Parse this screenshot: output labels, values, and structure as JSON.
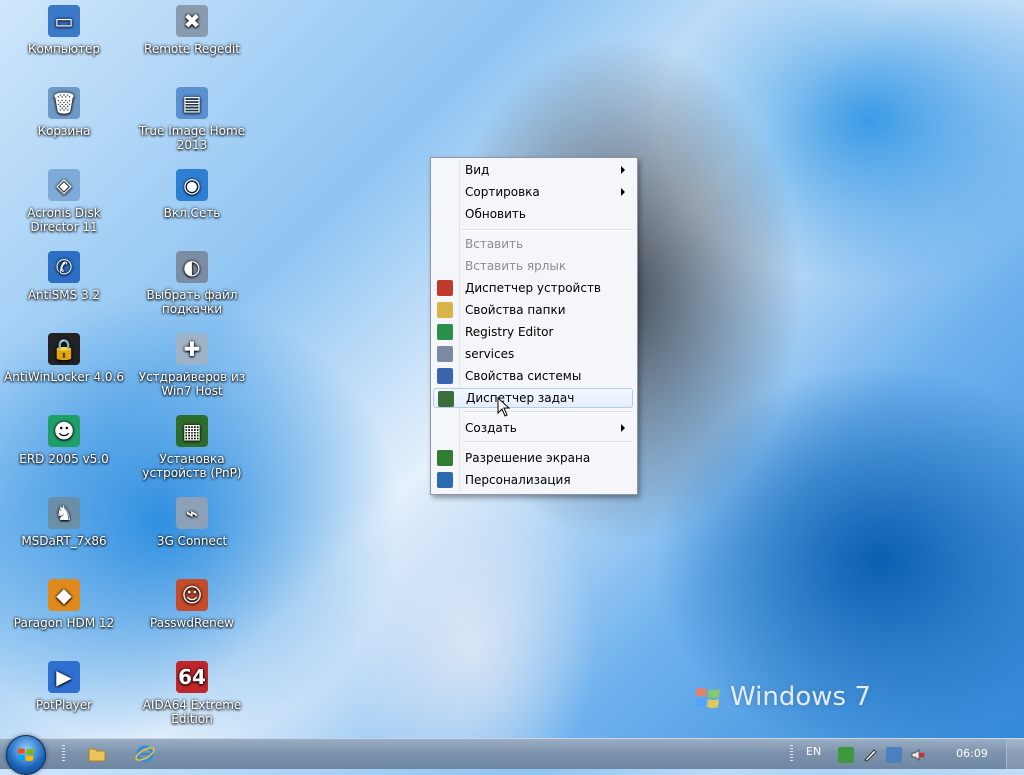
{
  "desktop_icons": [
    {
      "name": "computer-icon",
      "label": "Компьютер",
      "color": "#3a78c8",
      "glyph": "▭"
    },
    {
      "name": "remote-regedit-icon",
      "label": "Remote Regedit",
      "color": "#8a9bb0",
      "glyph": "✖"
    },
    {
      "name": "recycle-bin-icon",
      "label": "Корзина",
      "color": "#6e99c4",
      "glyph": "🗑"
    },
    {
      "name": "true-image-icon",
      "label": "True Image Home 2013",
      "color": "#5a8fd0",
      "glyph": "▤"
    },
    {
      "name": "acronis-disk-icon",
      "label": "Acronis Disk Director 11",
      "color": "#7fa9d6",
      "glyph": "◈"
    },
    {
      "name": "network-icon",
      "label": "Вкл.Сеть",
      "color": "#2e7fd4",
      "glyph": "◉"
    },
    {
      "name": "antisms-icon",
      "label": "AntiSMS 3.2",
      "color": "#2d6fc4",
      "glyph": "✆"
    },
    {
      "name": "select-file-icon",
      "label": "Выбрать файл подкачки",
      "color": "#7c8da3",
      "glyph": "◐"
    },
    {
      "name": "lock-icon",
      "label": "AntiWinLocker 4.0.6",
      "color": "#222222",
      "glyph": "🔒"
    },
    {
      "name": "driver-install-icon",
      "label": "Устдрайверов из Win7 Host",
      "color": "#9fb3c8",
      "glyph": "✚"
    },
    {
      "name": "erd-icon",
      "label": "ERD 2005 v5.0",
      "color": "#1f9e6a",
      "glyph": "☻"
    },
    {
      "name": "pnp-device-icon",
      "label": "Установка устройств (PnP)",
      "color": "#2f6b2a",
      "glyph": "▦"
    },
    {
      "name": "msdart-icon",
      "label": "MSDaRT_7x86",
      "color": "#6c8fa8",
      "glyph": "♞"
    },
    {
      "name": "usb-modem-icon",
      "label": "3G Connect",
      "color": "#8ca0b8",
      "glyph": "⌁"
    },
    {
      "name": "paragon-icon",
      "label": "Paragon HDM 12",
      "color": "#e08a1e",
      "glyph": "◆"
    },
    {
      "name": "users-icon",
      "label": "PasswdRenew",
      "color": "#c44b2b",
      "glyph": "☺"
    },
    {
      "name": "potplayer-icon",
      "label": "PotPlayer",
      "color": "#2f6fd0",
      "glyph": "▶"
    },
    {
      "name": "aida64-icon",
      "label": "AIDA64 Extreme Edition",
      "color": "#c0262a",
      "glyph": "64"
    }
  ],
  "context_menu": {
    "items": [
      {
        "name": "menu-item-view",
        "label": "Вид",
        "submenu": true
      },
      {
        "name": "menu-item-sort",
        "label": "Сортировка",
        "submenu": true
      },
      {
        "name": "menu-item-refresh",
        "label": "Обновить"
      },
      {
        "name": "menu-item-paste",
        "label": "Вставить",
        "disabled": true
      },
      {
        "name": "menu-item-paste-shortcut",
        "label": "Вставить ярлык",
        "disabled": true
      },
      {
        "name": "menu-item-device-manager",
        "label": "Диспетчер устройств",
        "icon": "device-manager-icon",
        "icon_color": "#c0392b"
      },
      {
        "name": "menu-item-folder-options",
        "label": "Свойства папки",
        "icon": "folder-options-icon",
        "icon_color": "#d9b44a"
      },
      {
        "name": "menu-item-registry-editor",
        "label": "Registry Editor",
        "icon": "registry-icon",
        "icon_color": "#2a8f4a"
      },
      {
        "name": "menu-item-services",
        "label": "services",
        "icon": "services-icon",
        "icon_color": "#7a8aa0"
      },
      {
        "name": "menu-item-system-properties",
        "label": "Свойства системы",
        "icon": "system-properties-icon",
        "icon_color": "#3a66b0"
      },
      {
        "name": "menu-item-task-manager",
        "label": "Диспетчер задач",
        "icon": "task-manager-icon",
        "icon_color": "#3c6e3c",
        "hover": true
      },
      {
        "name": "menu-item-create",
        "label": "Создать",
        "submenu": true
      },
      {
        "name": "menu-item-screen-resolution",
        "label": "Разрешение экрана",
        "icon": "screen-resolution-icon",
        "icon_color": "#2e7d32"
      },
      {
        "name": "menu-item-personalization",
        "label": "Персонализация",
        "icon": "personalization-icon",
        "icon_color": "#2b6cb0"
      }
    ]
  },
  "taskbar": {
    "language": "EN",
    "clock": "06:09"
  },
  "watermark": {
    "text": "Windows 7"
  }
}
